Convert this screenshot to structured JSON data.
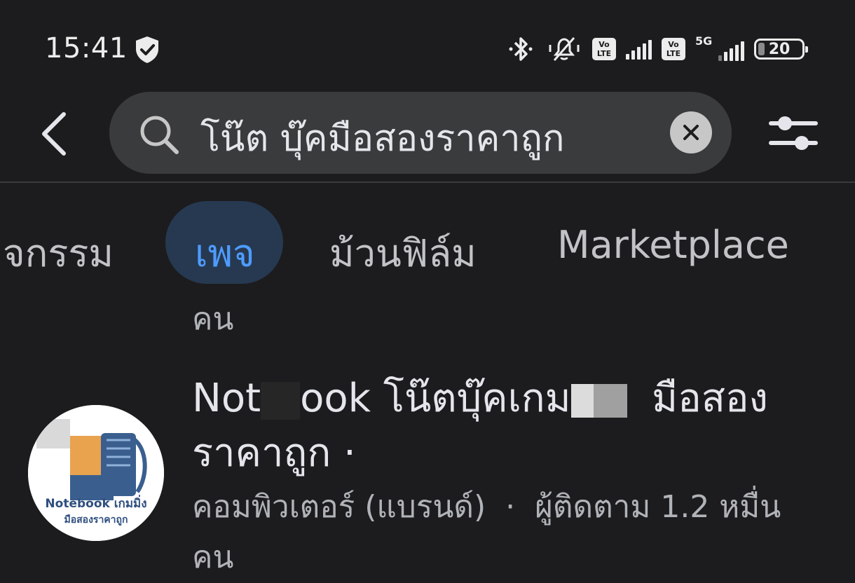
{
  "status_bar": {
    "time": "15:41",
    "volte_label_top": "Vo",
    "volte_label_bottom": "LTE",
    "network_label": "5G",
    "battery_level": "20"
  },
  "search": {
    "query": "โน๊ต บุ๊คมือสองราคาถูก"
  },
  "tabs": [
    {
      "label": "จกรรม"
    },
    {
      "label": "เพจ",
      "active": true
    },
    {
      "label": "ม้วนฟิล์ม"
    },
    {
      "label": "Marketplace"
    }
  ],
  "previous_item_tail": "คน",
  "result": {
    "title_part1": "Not",
    "title_part2": "ook โน๊ตบุ๊คเกม",
    "title_part3": "มือสอง",
    "title_line2": "ราคาถูก ·",
    "category": "คอมพิวเตอร์ (แบรนด์)",
    "separator": "·",
    "followers": "ผู้ติดตาม 1.2 หมื่น",
    "followers_tail": "คน",
    "avatar_text_line1": "Notebook เกมมิ่ง",
    "avatar_text_line2": "มือสองราคาถูก"
  },
  "colors": {
    "background": "#1c1c1e",
    "search_bg": "#3a3b3c",
    "active_tab_bg": "#263951",
    "active_tab_text": "#4e9cff",
    "avatar_orange": "#e9a24e",
    "avatar_blue": "#3a5f8f"
  }
}
